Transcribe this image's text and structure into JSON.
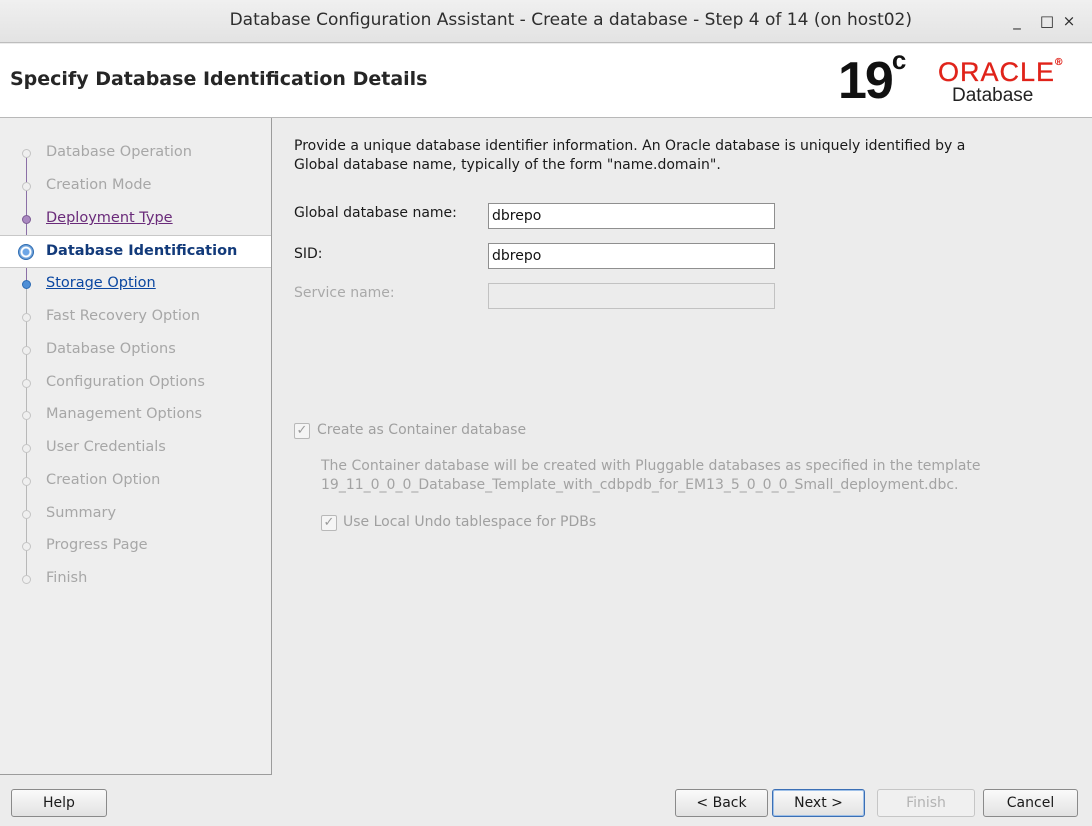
{
  "window": {
    "title": "Database Configuration Assistant - Create a database - Step 4 of 14 (on host02)",
    "minimize_glyph": "_",
    "maximize_glyph": "□",
    "close_glyph": "×"
  },
  "header": {
    "page_title": "Specify Database Identification Details",
    "logo": {
      "version": "19",
      "version_suffix": "c",
      "brand": "ORACLE",
      "brand_mark": "®",
      "product": "Database",
      "brand_color": "#e0231a"
    }
  },
  "steps": [
    {
      "label": "Database Operation",
      "state": "disabled"
    },
    {
      "label": "Creation Mode",
      "state": "disabled"
    },
    {
      "label": "Deployment Type",
      "state": "visited"
    },
    {
      "label": "Database Identification",
      "state": "current"
    },
    {
      "label": "Storage Option",
      "state": "link"
    },
    {
      "label": "Fast Recovery Option",
      "state": "disabled"
    },
    {
      "label": "Database Options",
      "state": "disabled"
    },
    {
      "label": "Configuration Options",
      "state": "disabled"
    },
    {
      "label": "Management Options",
      "state": "disabled"
    },
    {
      "label": "User Credentials",
      "state": "disabled"
    },
    {
      "label": "Creation Option",
      "state": "disabled"
    },
    {
      "label": "Summary",
      "state": "disabled"
    },
    {
      "label": "Progress Page",
      "state": "disabled"
    },
    {
      "label": "Finish",
      "state": "disabled"
    }
  ],
  "content": {
    "intro_line1": "Provide a unique database identifier information. An Oracle database is uniquely identified by a",
    "intro_line2": "Global database name, typically of the form \"name.domain\".",
    "global_db_name_label": "Global database name:",
    "global_db_name_value": "dbrepo",
    "sid_label": "SID:",
    "sid_value": "dbrepo",
    "service_name_label": "Service name:",
    "service_name_value": "",
    "container_checkbox_label": "Create as Container database",
    "container_checked": true,
    "container_note_line1": "The Container database will be created with Pluggable databases as specified in the template",
    "container_note_line2": "19_11_0_0_0_Database_Template_with_cdbpdb_for_EM13_5_0_0_0_Small_deployment.dbc.",
    "local_undo_label": "Use Local Undo tablespace for PDBs",
    "local_undo_checked": true,
    "check_glyph": "✓"
  },
  "footer": {
    "help": "Help",
    "back": "< Back",
    "next": "Next >",
    "finish": "Finish",
    "cancel": "Cancel"
  }
}
